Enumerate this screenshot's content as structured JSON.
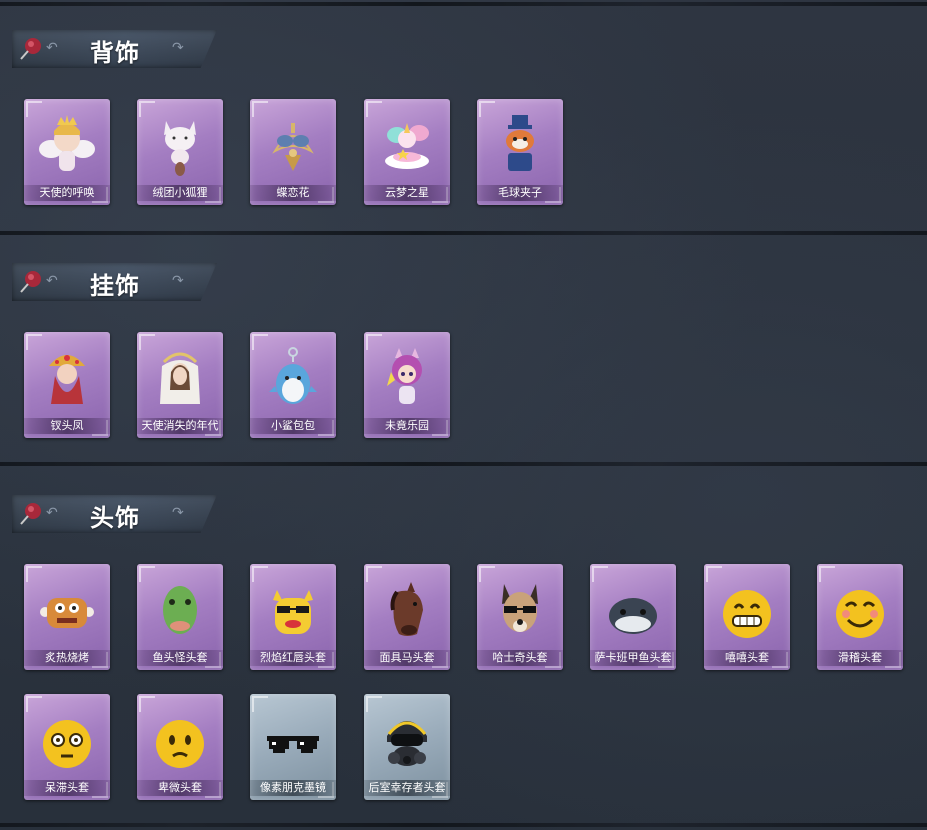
{
  "sections": [
    {
      "title": "背饰",
      "items": [
        {
          "label": "天使的呼唤",
          "icon": "angel-figure-icon",
          "rarity": "purple"
        },
        {
          "label": "绒团小狐狸",
          "icon": "fox-plush-icon",
          "rarity": "purple"
        },
        {
          "label": "蝶恋花",
          "icon": "butterfly-flower-icon",
          "rarity": "purple"
        },
        {
          "label": "云梦之星",
          "icon": "unicorn-cloud-icon",
          "rarity": "purple"
        },
        {
          "label": "毛球夹子",
          "icon": "raccoon-clip-icon",
          "rarity": "purple"
        }
      ]
    },
    {
      "title": "挂饰",
      "items": [
        {
          "label": "钗头凤",
          "icon": "phoenix-crown-icon",
          "rarity": "purple"
        },
        {
          "label": "天使消失的年代",
          "icon": "veiled-angel-icon",
          "rarity": "purple"
        },
        {
          "label": "小鲨包包",
          "icon": "shark-bag-icon",
          "rarity": "purple"
        },
        {
          "label": "未竟乐园",
          "icon": "purple-hair-girl-icon",
          "rarity": "purple"
        }
      ]
    },
    {
      "title": "头饰",
      "items": [
        {
          "label": "炙热烧烤",
          "icon": "grilled-meat-mask-icon",
          "rarity": "purple"
        },
        {
          "label": "鱼头怪头套",
          "icon": "fish-head-mask-icon",
          "rarity": "purple"
        },
        {
          "label": "烈焰红唇头套",
          "icon": "sunglasses-duck-mask-icon",
          "rarity": "purple"
        },
        {
          "label": "面具马头套",
          "icon": "horse-mask-icon",
          "rarity": "purple"
        },
        {
          "label": "哈士奇头套",
          "icon": "husky-mask-icon",
          "rarity": "purple"
        },
        {
          "label": "萨卡班甲鱼头套",
          "icon": "sacabambaspis-mask-icon",
          "rarity": "purple"
        },
        {
          "label": "嘻嘻头套",
          "icon": "grin-emoji-mask-icon",
          "rarity": "purple"
        },
        {
          "label": "滑稽头套",
          "icon": "funny-emoji-mask-icon",
          "rarity": "purple"
        },
        {
          "label": "呆滞头套",
          "icon": "dazed-emoji-mask-icon",
          "rarity": "purple"
        },
        {
          "label": "卑微头套",
          "icon": "humble-emoji-mask-icon",
          "rarity": "purple"
        },
        {
          "label": "像素朋克墨镜",
          "icon": "pixel-sunglasses-icon",
          "rarity": "grey"
        },
        {
          "label": "后室幸存者头套",
          "icon": "gas-mask-helmet-icon",
          "rarity": "grey"
        }
      ]
    }
  ],
  "colors": {
    "background": "#2b323d",
    "banner": "#3f4c5e",
    "purple_card": "#a47ec2",
    "grey_card": "#98aab9",
    "pin_red": "#a8283a"
  }
}
